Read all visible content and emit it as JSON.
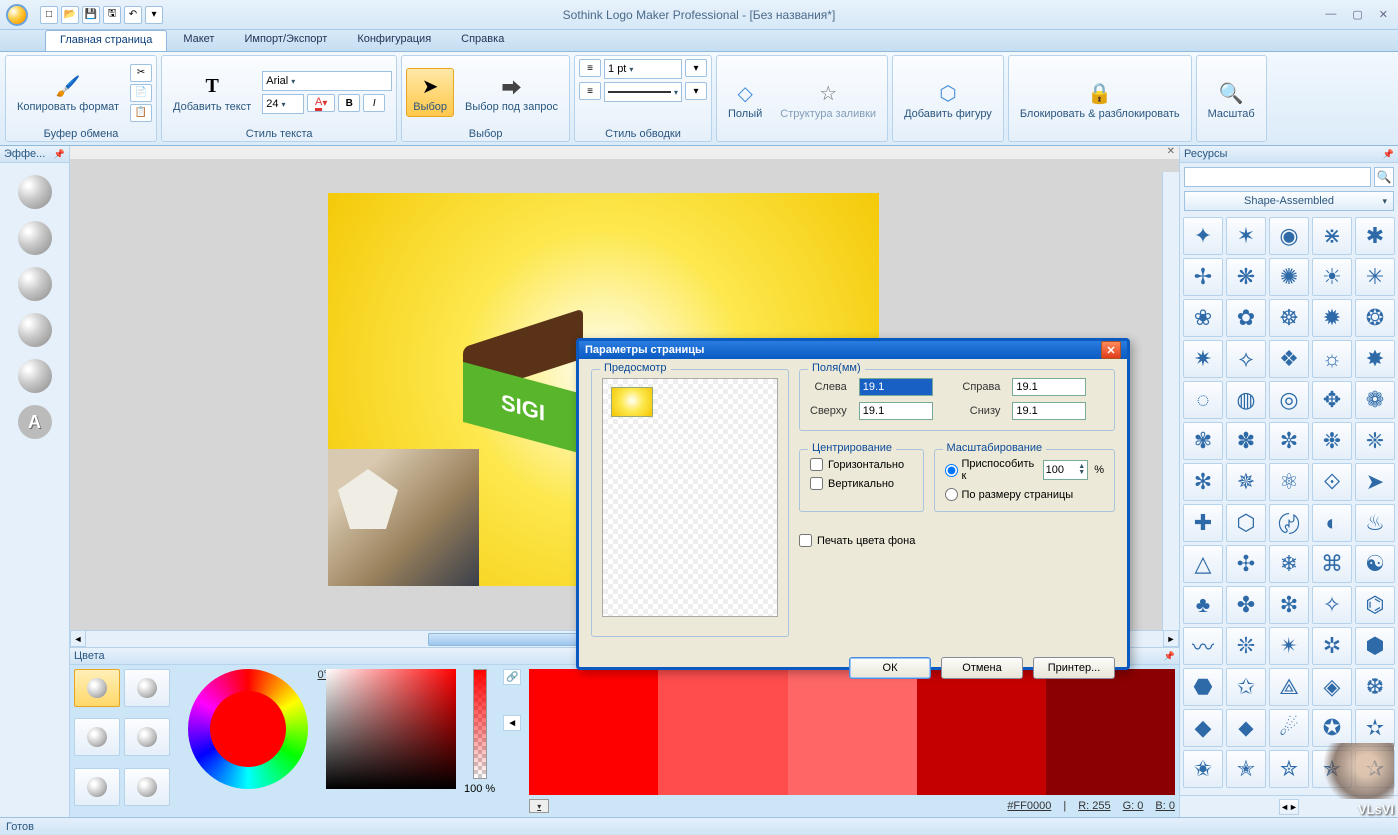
{
  "window": {
    "title": "Sothink Logo Maker Professional - [Без названия*]"
  },
  "qat": {
    "new": "□",
    "open": "📂",
    "save": "💾",
    "save_all": "🖫",
    "undo": "↶"
  },
  "tabs": [
    "Главная страница",
    "Макет",
    "Импорт/Экспорт",
    "Конфигурация",
    "Справка"
  ],
  "ribbon": {
    "clipboard": {
      "copyfmt": "Копировать формат",
      "cut": "✂",
      "copy": "📄",
      "paste": "📋",
      "label": "Буфер обмена"
    },
    "text": {
      "addtext": "Добавить текст",
      "font": "Arial",
      "size": "24",
      "bold": "B",
      "italic": "I",
      "color_ico": "A",
      "label": "Стиль текста"
    },
    "select": {
      "select": "Выбор",
      "selectq": "Выбор под запрос",
      "label": "Выбор"
    },
    "stroke": {
      "pt": "1 pt",
      "label": "Стиль обводки"
    },
    "fill": {
      "hollow": "Полый",
      "struct": "Структура заливки"
    },
    "shape": {
      "add": "Добавить фигуру"
    },
    "lock": {
      "lock": "Блокировать & разблокировать"
    },
    "zoom": {
      "zoom": "Масштаб"
    }
  },
  "panels": {
    "effects": "Эффе...",
    "colors": "Цвета",
    "resources": "Ресурсы"
  },
  "resources": {
    "search_ph": "",
    "category": "Shape-Assembled"
  },
  "colors": {
    "angle": "0°",
    "alpha": "100 %",
    "hex": "#FF0000",
    "r": "R: 255",
    "g": "G: 0",
    "b": "B: 0",
    "strip": [
      "#ff0000",
      "#ff3030",
      "#ff6060",
      "#c00000",
      "#8b0000"
    ]
  },
  "status": {
    "ready": "Готов"
  },
  "dialog": {
    "title": "Параметры страницы",
    "preview": "Предосмотр",
    "fields": "Поля(мм)",
    "left": "Слева",
    "right": "Справа",
    "top": "Сверху",
    "bottom": "Снизу",
    "left_v": "19.1",
    "right_v": "19.1",
    "top_v": "19.1",
    "bottom_v": "19.1",
    "center": "Центрирование",
    "horiz": "Горизонтально",
    "vert": "Вертикально",
    "scale": "Масштабирование",
    "fit": "Приспособить к",
    "fitpage": "По размеру страницы",
    "pct": "100",
    "pct_suffix": "%",
    "printbg": "Печать цвета фона",
    "ok": "ОК",
    "cancel": "Отмена",
    "printer": "Принтер..."
  },
  "watermark": "VLsVI"
}
